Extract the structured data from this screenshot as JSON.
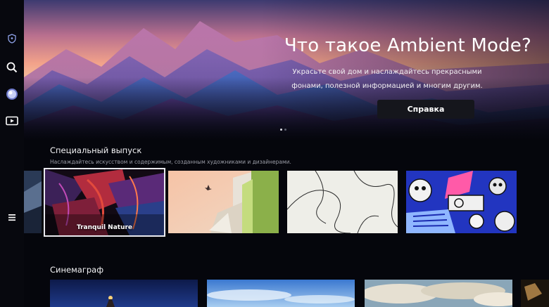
{
  "sidebar": {
    "items": [
      {
        "name": "shield-icon"
      },
      {
        "name": "search-icon"
      },
      {
        "name": "ambient-icon"
      },
      {
        "name": "media-icon"
      },
      {
        "name": "menu-icon"
      }
    ]
  },
  "hero": {
    "title": "Что такое Ambient Mode?",
    "subtitle": "Украсьте свой дом и наслаждайтесь прекрасными фонами, полезной информацией и многим другим.",
    "help_button": "Справка",
    "pager": {
      "count": 2,
      "active": 1
    }
  },
  "special": {
    "title": "Специальный выпуск",
    "subtitle": "Наслаждайтесь искусством и содержимым, созданным художниками и дизайнерами.",
    "tiles": [
      {
        "label": "Tranquil Nature",
        "focused": true
      },
      {
        "label": ""
      },
      {
        "label": ""
      },
      {
        "label": ""
      }
    ]
  },
  "cinemagraph": {
    "title": "Синемаграф"
  },
  "colors": {
    "background": "#05060c",
    "button": "#15161c",
    "focus": "#e9e9ee"
  }
}
